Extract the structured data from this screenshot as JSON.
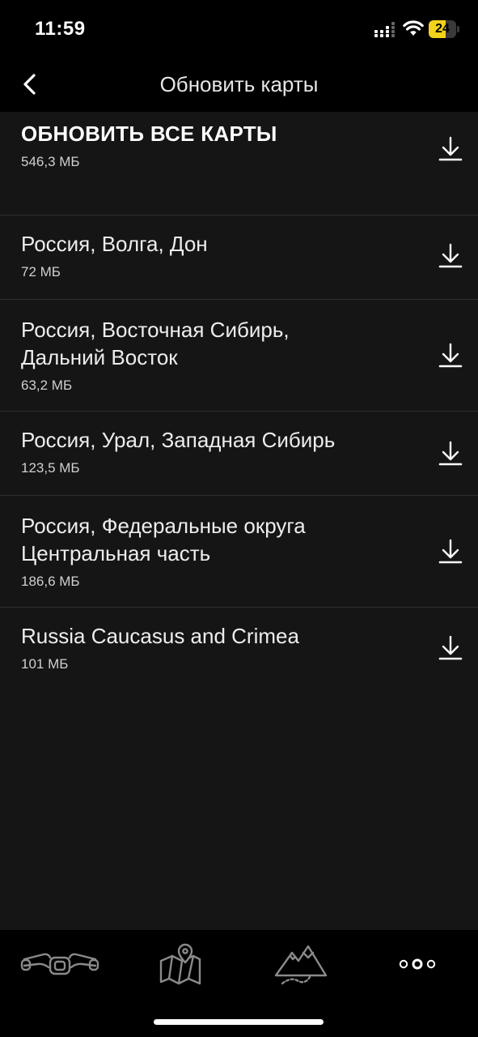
{
  "status_bar": {
    "time": "11:59",
    "battery_level": "24",
    "battery_fraction": 0.24,
    "battery_color": "#f2d21b",
    "icons": [
      "signal-icon",
      "wifi-icon",
      "battery-icon"
    ]
  },
  "header": {
    "back_icon": "chevron-left-icon",
    "title": "Обновить карты"
  },
  "update_all": {
    "title": "ОБНОВИТЬ ВСЕ КАРТЫ",
    "size": "546,3 МБ",
    "icon": "download-icon"
  },
  "maps": [
    {
      "title_lines": [
        "Россия, Волга, Дон"
      ],
      "size": "72 МБ",
      "icon": "download-icon"
    },
    {
      "title_lines": [
        "Россия, Восточная Сибирь,",
        "Дальний Восток"
      ],
      "size": "63,2 МБ",
      "icon": "download-icon"
    },
    {
      "title_lines": [
        "Россия, Урал, Западная Сибирь"
      ],
      "size": "123,5 МБ",
      "icon": "download-icon"
    },
    {
      "title_lines": [
        "Россия, Федеральные округа",
        "Центральная часть"
      ],
      "size": "186,6 МБ",
      "icon": "download-icon"
    },
    {
      "title_lines": [
        "Russia Caucasus and Crimea"
      ],
      "size": "101 МБ",
      "icon": "download-icon"
    }
  ],
  "tabbar": {
    "tabs": [
      {
        "icon": "motorcycle-handlebar-icon"
      },
      {
        "icon": "map-pin-icon"
      },
      {
        "icon": "mountains-icon"
      },
      {
        "icon": "more-dots-icon"
      }
    ],
    "accent_color": "#ffffff",
    "inactive_color": "#8a8a8a"
  }
}
